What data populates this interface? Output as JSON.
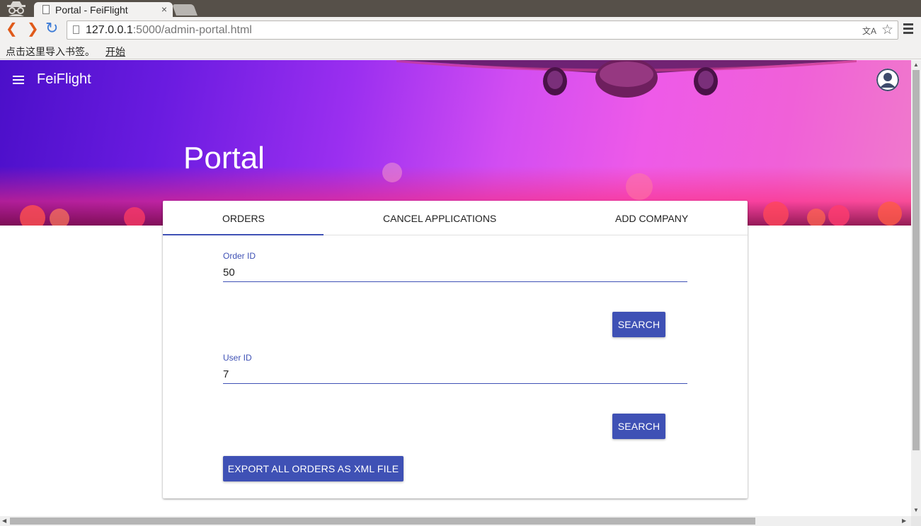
{
  "browser": {
    "tab_title": "Portal - FeiFlight",
    "tab_close": "×",
    "url_host": "127.0.0.1",
    "url_rest": ":5000/admin-portal.html",
    "bookmarks_prompt": "点击这里导入书签。",
    "bookmarks_link": "开始"
  },
  "header": {
    "brand": "FeiFlight",
    "title": "Portal"
  },
  "tabs": [
    {
      "label": "ORDERS",
      "active": true
    },
    {
      "label": "CANCEL APPLICATIONS",
      "active": false
    },
    {
      "label": "ADD COMPANY",
      "active": false
    }
  ],
  "order_search": {
    "label": "Order ID",
    "value": "50",
    "button": "SEARCH"
  },
  "user_search": {
    "label": "User ID",
    "value": "7",
    "button": "SEARCH"
  },
  "export_button": "EXPORT ALL ORDERS AS XML FILE",
  "colors": {
    "primary": "#3f51b5",
    "hero_start": "#4b0fc9",
    "hero_end": "#f07acb"
  }
}
